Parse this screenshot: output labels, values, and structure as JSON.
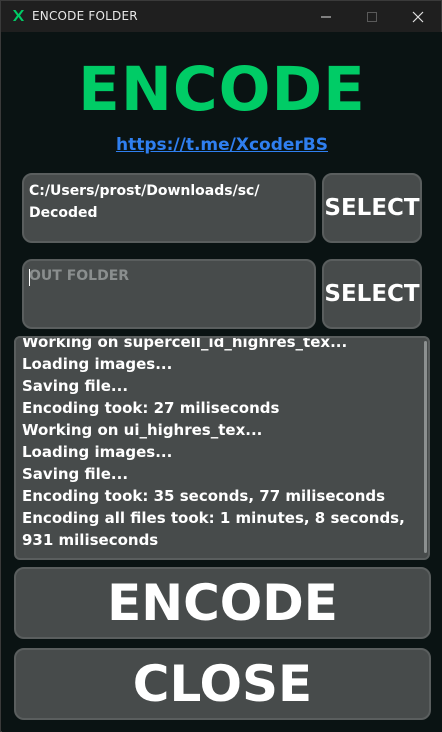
{
  "window": {
    "title": "ENCODE FOLDER",
    "colors": {
      "accent": "#00cc66",
      "link": "#2f7ff0",
      "panel": "#474b4b",
      "background": "#0a1313"
    }
  },
  "header": {
    "title": "ENCODE",
    "link": "https://t.me/XcoderBS"
  },
  "input_folder": {
    "value": "C:/Users/prost/Downloads/sc/\nDecoded",
    "select_label": "SELECT"
  },
  "output_folder": {
    "placeholder": "OUT FOLDER",
    "select_label": "SELECT"
  },
  "log": {
    "lines": [
      "Working on supercell_id_highres_tex...",
      "Loading images...",
      "Saving file...",
      "Encoding took: 27 miliseconds",
      "Working on ui_highres_tex...",
      "Loading images...",
      "Saving file...",
      "Encoding took: 35 seconds, 77 miliseconds",
      "Encoding all files took: 1 minutes, 8 seconds, 931 miliseconds"
    ]
  },
  "actions": {
    "encode_label": "ENCODE",
    "close_label": "CLOSE"
  }
}
